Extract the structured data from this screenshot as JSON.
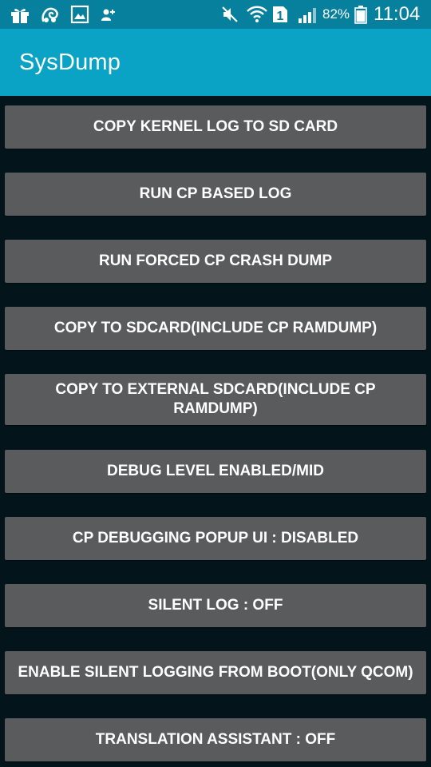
{
  "status_bar": {
    "battery_percent": "82%",
    "time": "11:04",
    "sim_slot": "1",
    "icons": [
      "gift-icon",
      "uc-browser-icon",
      "gallery-icon",
      "contact-update-icon",
      "mute-icon",
      "wifi-icon",
      "sim-icon",
      "signal-icon",
      "battery-icon"
    ]
  },
  "app_bar": {
    "title": "SysDump"
  },
  "buttons": [
    {
      "label": "COPY KERNEL LOG TO SD CARD"
    },
    {
      "label": "RUN CP BASED LOG"
    },
    {
      "label": "RUN FORCED CP CRASH DUMP"
    },
    {
      "label": "COPY TO SDCARD(INCLUDE CP RAMDUMP)"
    },
    {
      "label": "COPY TO EXTERNAL SDCARD(INCLUDE CP RAMDUMP)"
    },
    {
      "label": "DEBUG LEVEL ENABLED/MID"
    },
    {
      "label": "CP DEBUGGING POPUP UI : DISABLED"
    },
    {
      "label": "SILENT LOG : OFF"
    },
    {
      "label": "ENABLE SILENT LOGGING FROM BOOT(ONLY QCOM)"
    },
    {
      "label": "TRANSLATION ASSISTANT : OFF"
    }
  ],
  "colors": {
    "status_bar": "#06809c",
    "app_bar": "#0aa2c5",
    "background": "#04141b",
    "button": "#5a5b5d",
    "text": "#ffffff"
  }
}
